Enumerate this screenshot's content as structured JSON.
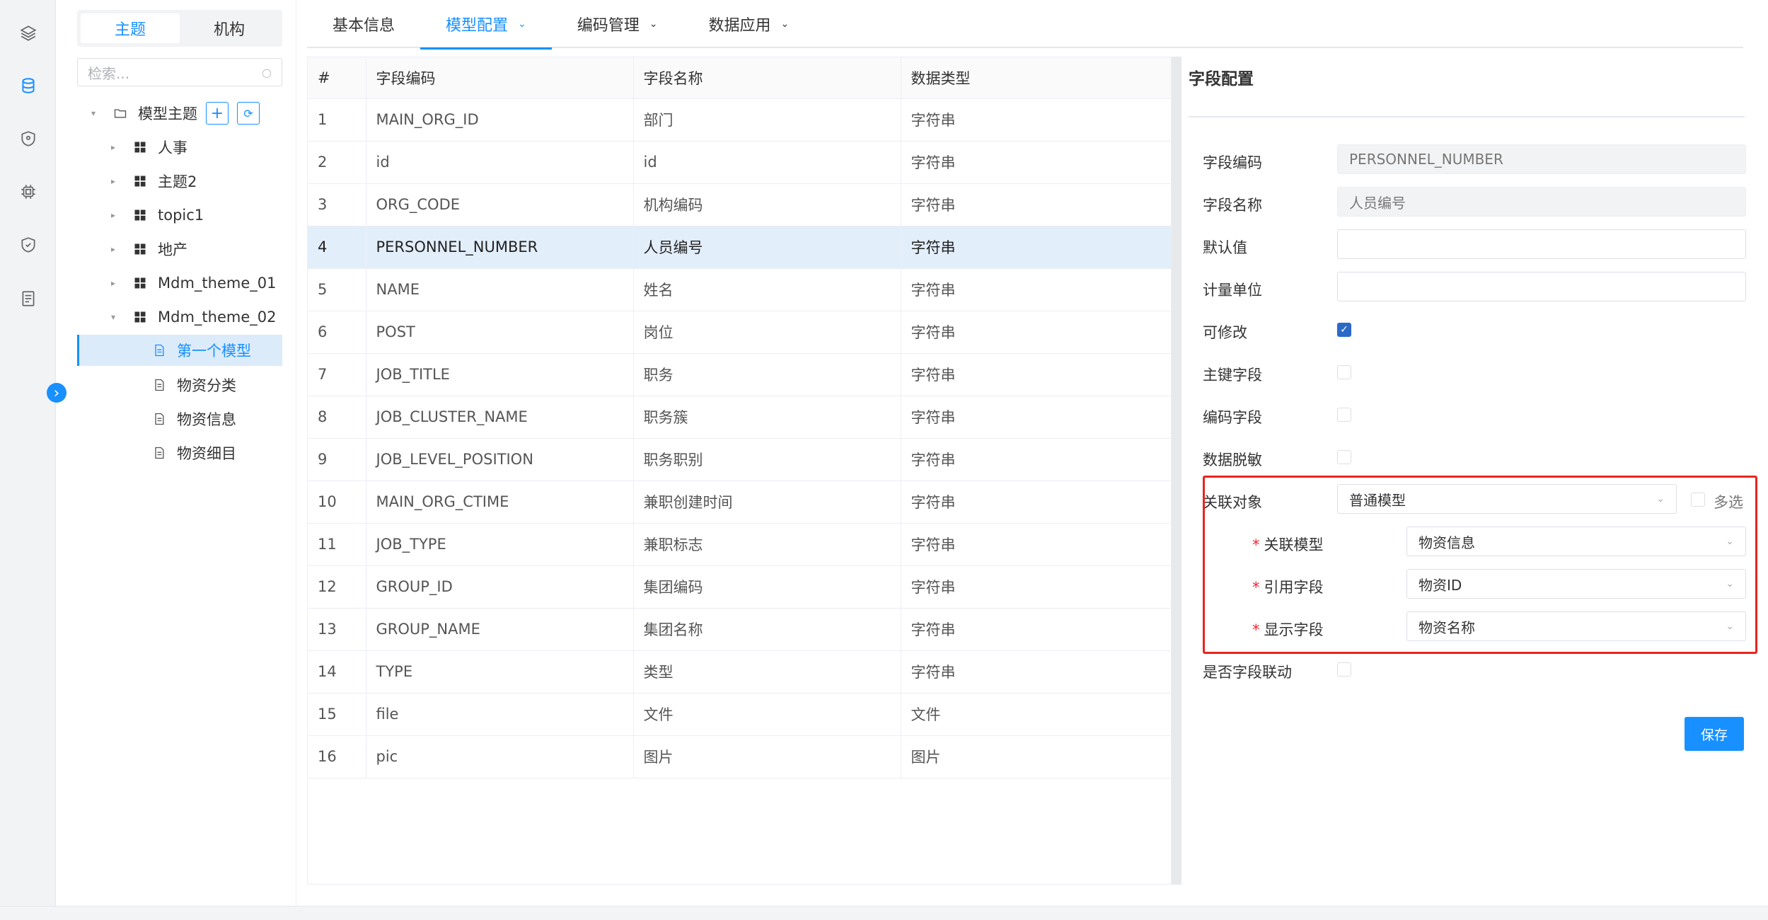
{
  "tree": {
    "segments": [
      "主题",
      "机构"
    ],
    "search_placeholder": "检索...",
    "root_label": "模型主题",
    "nodes": [
      "人事",
      "主题2",
      "topic1",
      "地产",
      "Mdm_theme_01",
      "Mdm_theme_02"
    ],
    "leaves": [
      "第一个模型",
      "物资分类",
      "物资信息",
      "物资细目"
    ]
  },
  "tabs": [
    {
      "label": "基本信息"
    },
    {
      "label": "模型配置"
    },
    {
      "label": "编码管理"
    },
    {
      "label": "数据应用"
    }
  ],
  "table": {
    "headers": [
      "#",
      "字段编码",
      "字段名称",
      "数据类型"
    ],
    "rows": [
      [
        "1",
        "MAIN_ORG_ID",
        "部门",
        "字符串"
      ],
      [
        "2",
        "id",
        "id",
        "字符串"
      ],
      [
        "3",
        "ORG_CODE",
        "机构编码",
        "字符串"
      ],
      [
        "4",
        "PERSONNEL_NUMBER",
        "人员编号",
        "字符串"
      ],
      [
        "5",
        "NAME",
        "姓名",
        "字符串"
      ],
      [
        "6",
        "POST",
        "岗位",
        "字符串"
      ],
      [
        "7",
        "JOB_TITLE",
        "职务",
        "字符串"
      ],
      [
        "8",
        "JOB_CLUSTER_NAME",
        "职务簇",
        "字符串"
      ],
      [
        "9",
        "JOB_LEVEL_POSITION",
        "职务职别",
        "字符串"
      ],
      [
        "10",
        "MAIN_ORG_CTIME",
        "兼职创建时间",
        "字符串"
      ],
      [
        "11",
        "JOB_TYPE",
        "兼职标志",
        "字符串"
      ],
      [
        "12",
        "GROUP_ID",
        "集团编码",
        "字符串"
      ],
      [
        "13",
        "GROUP_NAME",
        "集团名称",
        "字符串"
      ],
      [
        "14",
        "TYPE",
        "类型",
        "字符串"
      ],
      [
        "15",
        "file",
        "文件",
        "文件"
      ],
      [
        "16",
        "pic",
        "图片",
        "图片"
      ]
    ]
  },
  "config": {
    "title": "字段配置",
    "field_code_label": "字段编码",
    "field_code_value": "PERSONNEL_NUMBER",
    "field_name_label": "字段名称",
    "field_name_value": "人员编号",
    "default_label": "默认值",
    "unit_label": "计量单位",
    "editable_label": "可修改",
    "pk_label": "主键字段",
    "code_field_label": "编码字段",
    "mask_label": "数据脱敏",
    "relation_label": "关联对象",
    "relation_value": "普通模型",
    "multi_label": "多选",
    "rel_model_label": "关联模型",
    "rel_model_value": "物资信息",
    "ref_field_label": "引用字段",
    "ref_field_value": "物资ID",
    "display_field_label": "显示字段",
    "display_field_value": "物资名称",
    "linkage_label": "是否字段联动",
    "save_label": "保存"
  }
}
